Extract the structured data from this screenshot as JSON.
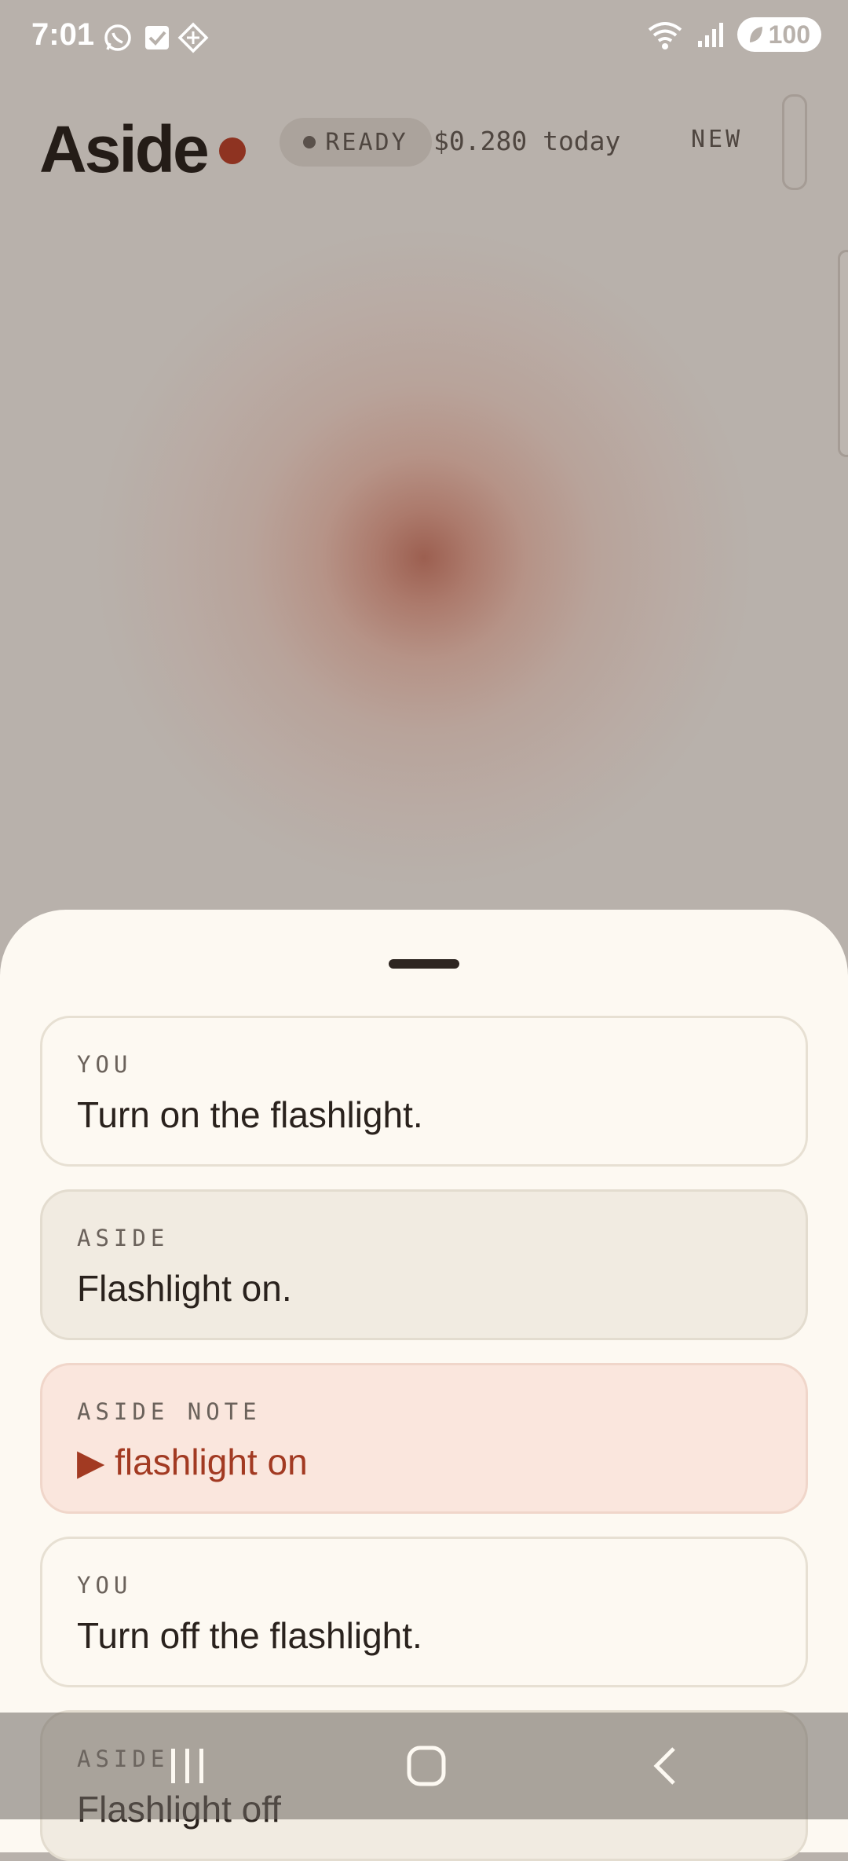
{
  "status_bar": {
    "time": "7:01",
    "left_icons": [
      "whatsapp-icon",
      "checkbox-icon",
      "diamond-app-icon"
    ],
    "right_icons": [
      "wifi-icon",
      "signal-icon"
    ],
    "battery": "100"
  },
  "header": {
    "title": "Aside",
    "status_label": "READY",
    "cost": "$0.280 today",
    "new_label": "NEW"
  },
  "colors": {
    "accent": "#8e3321",
    "background": "#b8b1ab",
    "sheet": "#fdf9f2",
    "note_bg": "#fae6dd",
    "note_text": "#a23a22"
  },
  "messages": [
    {
      "role": "YOU",
      "text": "Turn on the flashlight."
    },
    {
      "role": "ASIDE",
      "text": "Flashlight on."
    },
    {
      "role": "ASIDE NOTE",
      "text": "▶ flashlight on"
    },
    {
      "role": "YOU",
      "text": "Turn off the flashlight."
    },
    {
      "role": "ASIDE",
      "text": "Flashlight off"
    }
  ],
  "nav_bar": {
    "icons": [
      "recents-icon",
      "home-icon",
      "back-icon"
    ]
  }
}
